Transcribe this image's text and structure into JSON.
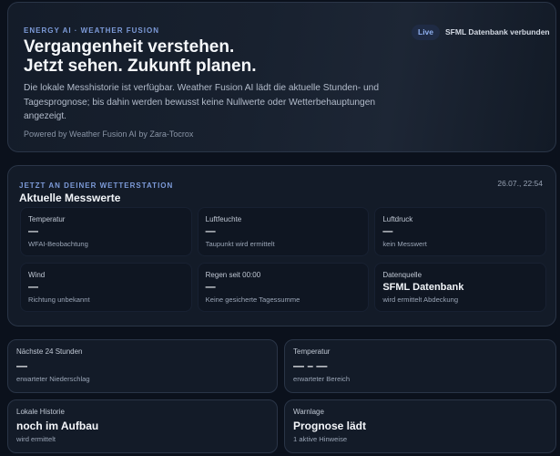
{
  "hero": {
    "eyebrow": "ENERGY AI · WEATHER FUSION",
    "title_line1": "Vergangenheit verstehen.",
    "title_line2": "Jetzt sehen. Zukunft planen.",
    "description": "Die lokale Messhistorie ist verfügbar. Weather Fusion AI lädt die aktuelle Stunden- und Tagesprognose; bis dahin werden bewusst keine Nullwerte oder Wetterbehauptungen angezeigt.",
    "powered_by": "Powered by Weather Fusion AI by Zara-Tocrox",
    "badge_live": "Live",
    "badge_source": "SFML Datenbank verbunden"
  },
  "station": {
    "eyebrow": "JETZT AN DEINER WETTERSTATION",
    "title": "Aktuelle Messwerte",
    "timestamp": "26.07., 22:54",
    "cells": [
      {
        "label": "Temperatur",
        "value": "—",
        "sub": "WFAI-Beobachtung"
      },
      {
        "label": "Luftfeuchte",
        "value": "—",
        "sub": "Taupunkt wird ermittelt"
      },
      {
        "label": "Luftdruck",
        "value": "—",
        "sub": "kein Messwert"
      },
      {
        "label": "Wind",
        "value": "—",
        "sub": "Richtung unbekannt"
      },
      {
        "label": "Regen seit 00:00",
        "value": "—",
        "sub": "Keine gesicherte Tagessumme"
      },
      {
        "label": "Datenquelle",
        "value": "SFML Datenbank",
        "sub": "wird ermittelt Abdeckung"
      }
    ]
  },
  "cards": [
    {
      "label": "Nächste 24 Stunden",
      "value": "—",
      "sub": "erwarteter Niederschlag"
    },
    {
      "label": "Temperatur",
      "value": "— – —",
      "sub": "erwarteter Bereich"
    },
    {
      "label": "Lokale Historie",
      "value": "noch im Aufbau",
      "sub": "wird ermittelt"
    },
    {
      "label": "Warnlage",
      "value": "Prognose lädt",
      "sub": "1 aktive Hinweise"
    }
  ]
}
